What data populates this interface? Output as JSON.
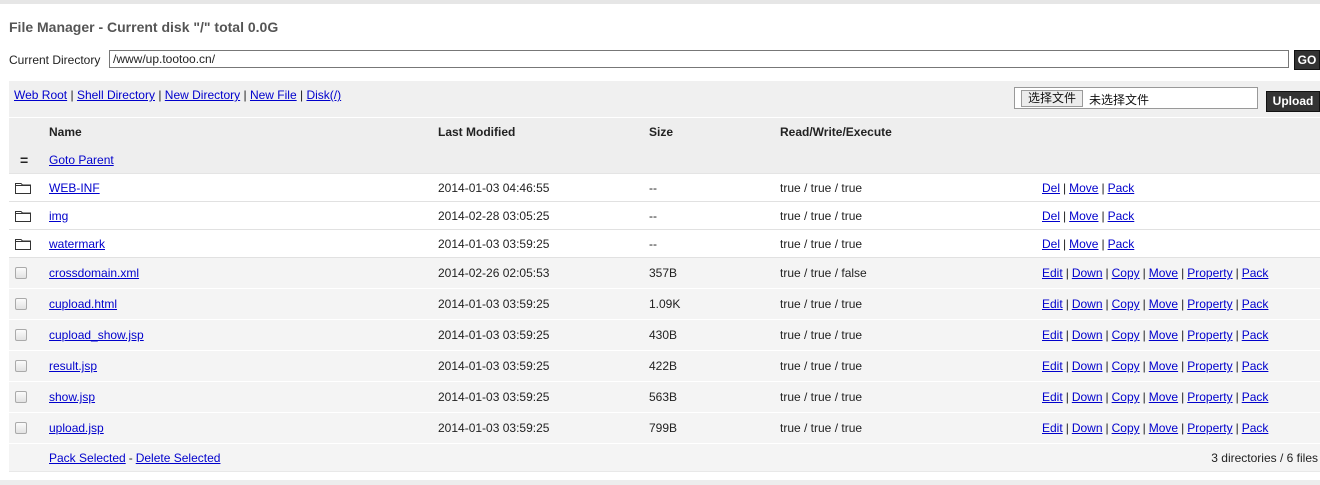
{
  "page": {
    "title": "File Manager - Current disk \"/\" total 0.0G"
  },
  "path_bar": {
    "label": "Current Directory",
    "value": "/www/up.tootoo.cn/",
    "go_label": "GO"
  },
  "toolbar": {
    "links": [
      "Web Root",
      "Shell Directory",
      "New Directory",
      "New File",
      "Disk(/)"
    ],
    "separator": "|",
    "file_choose_label": "选择文件",
    "file_status": "未选择文件",
    "upload_label": "Upload"
  },
  "columns": {
    "name": "Name",
    "modified": "Last Modified",
    "size": "Size",
    "rwx": "Read/Write/Execute"
  },
  "parent_row": {
    "icon": "=",
    "label": "Goto Parent"
  },
  "directories": [
    {
      "name": "WEB-INF",
      "modified": "2014-01-03 04:46:55",
      "size": "--",
      "rwx": "true / true / true",
      "ops": [
        "Del",
        "Move",
        "Pack"
      ]
    },
    {
      "name": "img",
      "modified": "2014-02-28 03:05:25",
      "size": "--",
      "rwx": "true / true / true",
      "ops": [
        "Del",
        "Move",
        "Pack"
      ]
    },
    {
      "name": "watermark",
      "modified": "2014-01-03 03:59:25",
      "size": "--",
      "rwx": "true / true / true",
      "ops": [
        "Del",
        "Move",
        "Pack"
      ]
    }
  ],
  "files": [
    {
      "name": "crossdomain.xml",
      "modified": "2014-02-26 02:05:53",
      "size": "357B",
      "rwx": "true / true / false",
      "ops": [
        "Edit",
        "Down",
        "Copy",
        "Move",
        "Property",
        "Pack"
      ]
    },
    {
      "name": "cupload.html",
      "modified": "2014-01-03 03:59:25",
      "size": "1.09K",
      "rwx": "true / true / true",
      "ops": [
        "Edit",
        "Down",
        "Copy",
        "Move",
        "Property",
        "Pack"
      ]
    },
    {
      "name": "cupload_show.jsp",
      "modified": "2014-01-03 03:59:25",
      "size": "430B",
      "rwx": "true / true / true",
      "ops": [
        "Edit",
        "Down",
        "Copy",
        "Move",
        "Property",
        "Pack"
      ]
    },
    {
      "name": "result.jsp",
      "modified": "2014-01-03 03:59:25",
      "size": "422B",
      "rwx": "true / true / true",
      "ops": [
        "Edit",
        "Down",
        "Copy",
        "Move",
        "Property",
        "Pack"
      ]
    },
    {
      "name": "show.jsp",
      "modified": "2014-01-03 03:59:25",
      "size": "563B",
      "rwx": "true / true / true",
      "ops": [
        "Edit",
        "Down",
        "Copy",
        "Move",
        "Property",
        "Pack"
      ]
    },
    {
      "name": "upload.jsp",
      "modified": "2014-01-03 03:59:25",
      "size": "799B",
      "rwx": "true / true / true",
      "ops": [
        "Edit",
        "Down",
        "Copy",
        "Move",
        "Property",
        "Pack"
      ]
    }
  ],
  "footer": {
    "pack_selected": "Pack Selected",
    "dash": "-",
    "delete_selected": "Delete Selected",
    "summary": "3 directories / 6 files"
  },
  "icons": {
    "folder": "folder-icon",
    "file_select": "checkbox",
    "parent": "parent-icon"
  },
  "colors": {
    "link": "#0000cc",
    "button_dark": "#333333",
    "header_bg": "#eeeeee"
  }
}
